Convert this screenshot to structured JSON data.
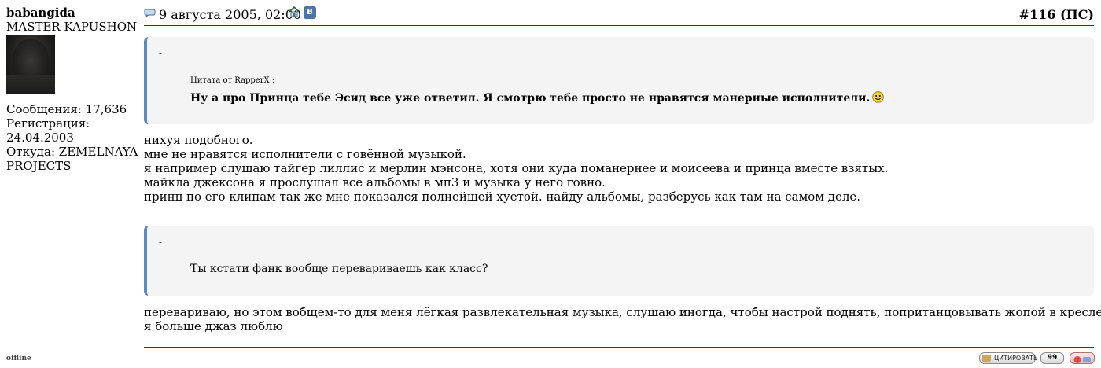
{
  "user": {
    "name": "babangida",
    "title": "MASTER KAPUSHON",
    "messages": "Сообщения: 17,636",
    "registration": "Регистрация: 24.04.2003",
    "location_line1": "Откуда: ZEMELNAYA",
    "location_line2": "PROJECTS",
    "status": "offline"
  },
  "post": {
    "date": "9 августа 2005, 02:00",
    "number": "#116",
    "number_suffix": "(ПС)",
    "vk_label": "В",
    "icons": [
      "post-icon",
      "home-icon",
      "vk-icon",
      "smile-icon",
      "sleepy-smile-icon",
      "quote-icon",
      "multiquote-icon",
      "report-icon"
    ]
  },
  "quote1": {
    "dash": "-",
    "header": "Цитата от RapperX :",
    "text": "Ну а про Принца тебе Эсид все уже ответил. Я смотрю тебе просто не нравятся манерные исполнители."
  },
  "body1": [
    "нихуя подобного.",
    "мне не нравятся исполнители с говённой музыкой.",
    "я например слушаю тайгер лиллис и мерлин мэнсона, хотя они куда поманернее и моисеева и принца вместе взятых.",
    "майкла джексона я прослушал все альбомы в мп3 и музыка у него говно.",
    "принц по его клипам так же мне показался полнейшей хуетой. найду альбомы, разберусь как там на самом деле."
  ],
  "quote2": {
    "dash": "-",
    "text": "Ты кстати фанк вообще перевариваешь как класс?"
  },
  "body2": [
    "перевариваю, но этом вобщем-то для меня лёгкая развлекательная музыка, слушаю иногда, чтобы настрой поднять, попританцовывать жопой в кресле",
    "я больше джаз люблю"
  ],
  "footer": {
    "quote_button": "ЦИТИРОВАТЬ",
    "multi_button": "99"
  },
  "colors": {
    "quote_border": "#5b89c2",
    "quote_bg": "#f4f4f4",
    "rule": "#1f3a5a"
  }
}
